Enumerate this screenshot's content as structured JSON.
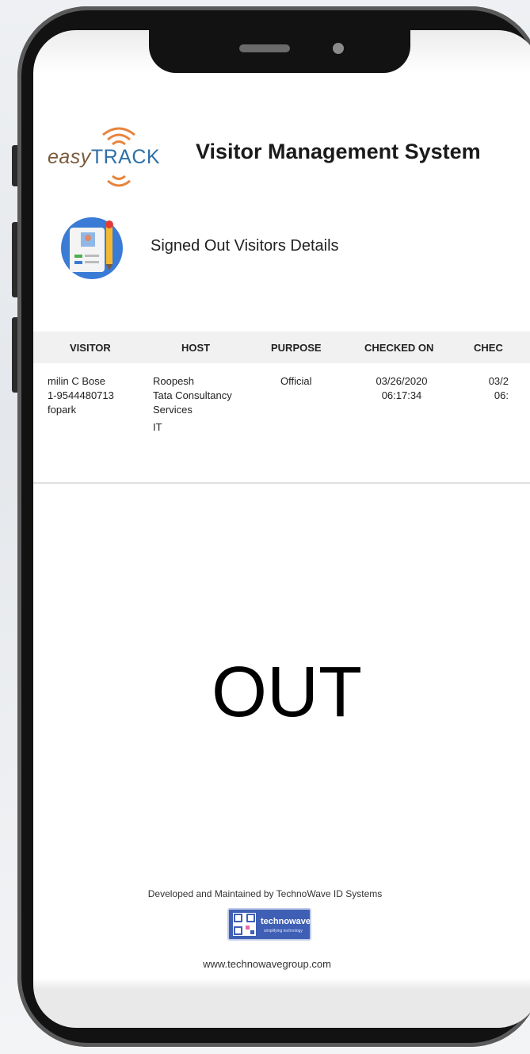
{
  "app": {
    "brand_prefix": "easy",
    "brand_main": "TR",
    "brand_a": "A",
    "brand_tail": "CK",
    "title": "Visitor Management System"
  },
  "section": {
    "title": "Signed Out Visitors  Details"
  },
  "table": {
    "headers": [
      "VISITOR",
      "HOST",
      "PURPOSE",
      "CHECKED ON",
      "CHEC"
    ],
    "rows": [
      {
        "visitor_name": "milin C Bose",
        "visitor_phone": "1-9544480713",
        "visitor_location": "fopark",
        "host_name": "Roopesh",
        "host_company_1": "Tata Consultancy",
        "host_company_2": "Services",
        "host_department": "IT",
        "purpose": "Official",
        "checked_on_date": "03/26/2020",
        "checked_on_time": "06:17:34",
        "checked_out_date": "03/2",
        "checked_out_time": "06:"
      }
    ]
  },
  "status": {
    "label": "OUT"
  },
  "footer": {
    "developed_by": "Developed and Maintained by TechnoWave ID Systems",
    "badge_word": "technowave",
    "badge_tagline": "simplifying technology",
    "website": "www.technowavegroup.com"
  },
  "colors": {
    "brand_orange": "#e8843c",
    "brand_blue": "#2f6fa8",
    "phone_frame": "#121212",
    "badge_blue": "#3f5fb5"
  }
}
